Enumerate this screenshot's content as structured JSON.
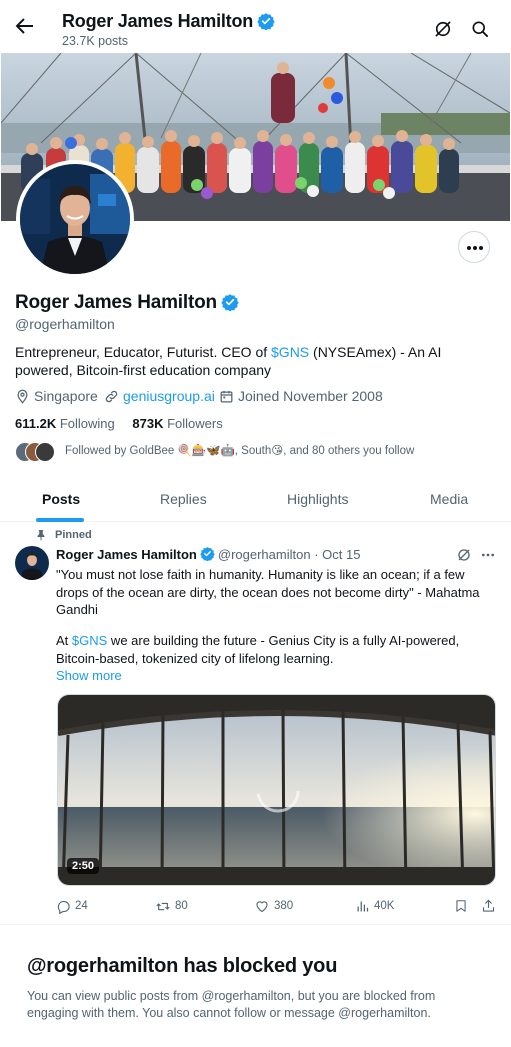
{
  "header": {
    "name": "Roger James Hamilton",
    "posts_count": "23.7K posts",
    "back_icon": "back-arrow-icon",
    "grok_icon": "grok-icon",
    "search_icon": "search-icon"
  },
  "profile": {
    "name": "Roger James Hamilton",
    "handle": "@rogerhamilton",
    "bio_prefix": "Entrepreneur, Educator, Futurist. CEO of ",
    "bio_cashtag": "$GNS",
    "bio_suffix": " (NYSEAmex) - An AI powered, Bitcoin-first education company",
    "location": "Singapore",
    "website": "geniusgroup.ai",
    "joined": "Joined November 2008",
    "following_count": "611.2K",
    "following_label": "Following",
    "followers_count": "873K",
    "followers_label": "Followers",
    "followed_by_prefix": "Followed by GoldBee",
    "followed_by_middle": ", South",
    "followed_by_suffix": ", and 80 others you follow"
  },
  "tabs": [
    {
      "label": "Posts",
      "active": true
    },
    {
      "label": "Replies",
      "active": false
    },
    {
      "label": "Highlights",
      "active": false
    },
    {
      "label": "Media",
      "active": false
    }
  ],
  "pinned_post": {
    "pinned_label": "Pinned",
    "author_name": "Roger James Hamilton",
    "author_handle": "@rogerhamilton",
    "separator": "·",
    "date": "Oct 15",
    "text_quote": "\"You must not lose faith in humanity. Humanity is like an ocean; if a few drops of the ocean are dirty, the ocean does not become dirty\" - Mahatma Gandhi",
    "text_prefix": "At ",
    "text_cashtag": "$GNS",
    "text_suffix": " we are building the future - Genius City is a fully AI-powered, Bitcoin-based, tokenized city of lifelong learning.",
    "show_more": "Show more",
    "video_duration": "2:50",
    "replies": "24",
    "reposts": "80",
    "likes": "380",
    "views": "40K"
  },
  "blocked": {
    "title": "@rogerhamilton has blocked you",
    "message": "You can view public posts from @rogerhamilton, but you are blocked from engaging with them. You also cannot follow or message @rogerhamilton."
  },
  "colors": {
    "accent": "#1d9bf0",
    "text_primary": "#0f1419",
    "text_secondary": "#536471",
    "border": "#eff3f4"
  }
}
